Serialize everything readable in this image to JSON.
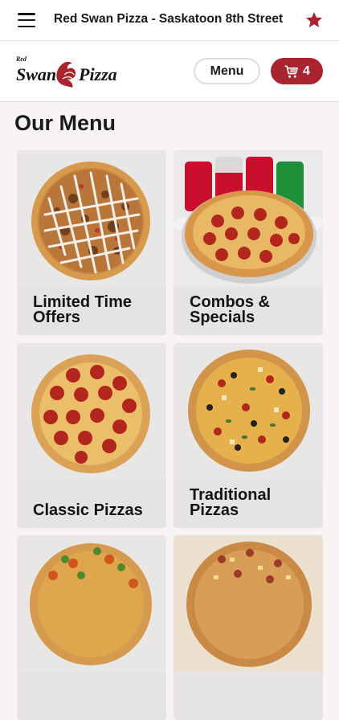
{
  "header": {
    "store_title": "Red Swan Pizza - Saskatoon 8th Street",
    "menu_icon": "hamburger-icon",
    "favorite_icon": "star-icon",
    "favorite_color": "#a8242f"
  },
  "brand": {
    "logo_text": "Red Swan Pizza",
    "logo_small_text": "Red",
    "logo_color": "#a8242f",
    "menu_button_label": "Menu",
    "cart_icon": "cart-icon",
    "cart_count": "4",
    "accent_color": "#a8242f"
  },
  "main": {
    "section_title": "Our Menu",
    "categories": [
      {
        "label": "Limited Time Offers",
        "image": "drizzled-pizza"
      },
      {
        "label": "Combos & Specials",
        "image": "pepperoni-pizza-with-sodas"
      },
      {
        "label": "Classic Pizzas",
        "image": "pepperoni-pizza"
      },
      {
        "label": "Traditional Pizzas",
        "image": "supreme-pizza"
      },
      {
        "label": "",
        "image": "veggie-pizza"
      },
      {
        "label": "",
        "image": "hawaiian-pizza"
      }
    ]
  }
}
